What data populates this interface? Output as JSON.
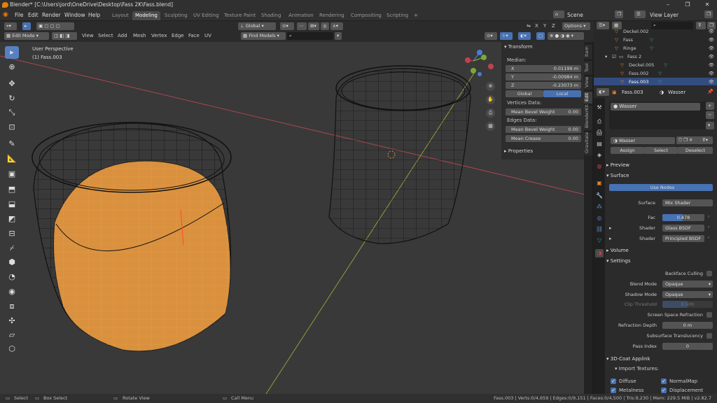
{
  "title": "Blender* [C:\\Users\\jord\\OneDrive\\Desktop\\Fass 2K\\Fass.blend]",
  "menu": [
    "File",
    "Edit",
    "Render",
    "Window",
    "Help"
  ],
  "workspaces": [
    "Layout",
    "Modeling",
    "Sculpting",
    "UV Editing",
    "Texture Paint",
    "Shading",
    "Animation",
    "Rendering",
    "Compositing",
    "Scripting"
  ],
  "active_workspace": "Modeling",
  "scene_label": "Scene",
  "view_layer_label": "View Layer",
  "header": {
    "mode": "Edit Mode",
    "menus": [
      "View",
      "Select",
      "Add",
      "Mesh",
      "Vertex",
      "Edge",
      "Face",
      "UV"
    ],
    "orientation": "Global",
    "find": "Find Models",
    "options": "Options",
    "axes": [
      "X",
      "Y",
      "Z"
    ]
  },
  "viewport": {
    "perspective": "User Perspective",
    "object": "(1) Fass.003"
  },
  "npanel": {
    "transform_title": "Transform",
    "median_label": "Median:",
    "x_label": "X",
    "x": "0.01199 m",
    "y_label": "Y",
    "y": "-0.00984 m",
    "z_label": "Z",
    "z": "-0.23073 m",
    "global": "Global",
    "local": "Local",
    "vertices_data": "Vertices Data:",
    "mean_bevel_weight": "Mean Bevel Weight",
    "vb": "0.00",
    "edges_data": "Edges Data:",
    "eb": "0.00",
    "mean_crease": "Mean Crease",
    "ec": "0.00",
    "properties": "Properties",
    "tabs": [
      "Item",
      "Tool",
      "View",
      "Edit",
      "BlenderKit",
      "Gravitate"
    ]
  },
  "outliner": [
    {
      "name": "Deckel.002"
    },
    {
      "name": "Fass"
    },
    {
      "name": "Ringe"
    },
    {
      "name": "Fass 2"
    },
    {
      "name": "Deckel.005"
    },
    {
      "name": "Fass.002"
    },
    {
      "name": "Fass.003"
    }
  ],
  "props": {
    "object": "Fass.003",
    "material": "Wasser",
    "slot": "Wasser",
    "mat_field": "Wasser",
    "assign": "Assign",
    "select": "Select",
    "deselect": "Deselect",
    "preview": "Preview",
    "surface": "Surface",
    "use_nodes": "Use Nodes",
    "surface_label": "Surface",
    "surface_val": "Mix Shader",
    "fac_label": "Fac",
    "fac_val": "0.478",
    "fac": 0.478,
    "shader_label": "Shader",
    "shader1": "Glass BSDF",
    "shader_label2": "Shader",
    "shader2": "Principled BSDF",
    "volume": "Volume",
    "settings": "Settings",
    "backface": "Backface Culling",
    "blend_label": "Blend Mode",
    "blend_val": "Opaque",
    "shadow_label": "Shadow Mode",
    "shadow_val": "Opaque",
    "clip_label": "Clip Threshold",
    "clip_val": "0.500",
    "ssr": "Screen Space Refraction",
    "rdepth_label": "Refraction Depth",
    "rdepth_val": "0 m",
    "sst": "Subsurface Translucency",
    "pass_label": "Pass Index",
    "pass_val": "0",
    "coat": "3D-Coat Applink",
    "import_tex": "Import Textures:",
    "diffuse": "Diffuse",
    "normalmap": "NormalMap",
    "metalness": "Metalness",
    "displacement": "Displacement"
  },
  "status": {
    "select": "Select",
    "box": "Box Select",
    "rotate": "Rotate View",
    "call": "Call Menu",
    "stats": "Fass.003 | Verts:0/4,659 | Edges:0/9,151 | Faces:0/4,500 | Tris:9,230 | Mem: 229.5 MiB | v2.82.7"
  },
  "colors": {
    "accent": "#4772b3",
    "selection": "#e8892a",
    "fill": "#d9913f"
  }
}
